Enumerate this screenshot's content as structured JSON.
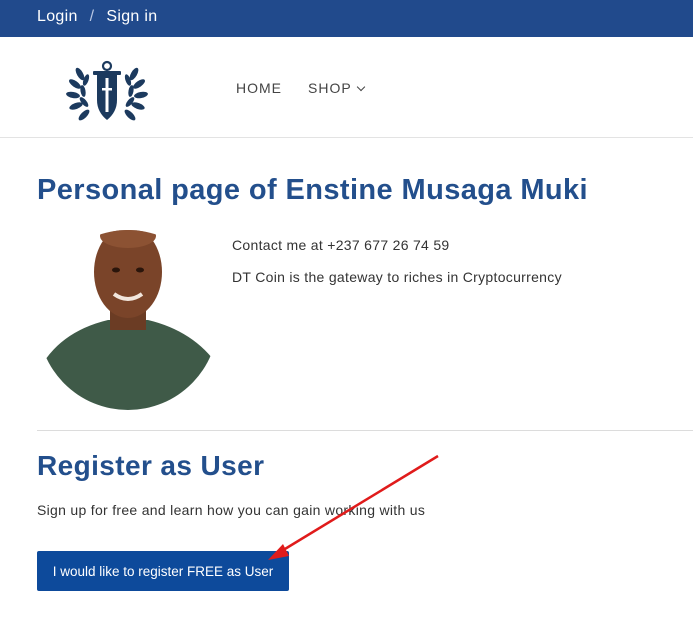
{
  "topbar": {
    "login": "Login",
    "separator": "/",
    "signin": "Sign in",
    "bg": "#214a8c"
  },
  "header": {
    "logo_icon": "anchor-laurel-logo",
    "nav": [
      {
        "label": "HOME"
      },
      {
        "label": "SHOP"
      }
    ]
  },
  "profile": {
    "title": "Personal page of Enstine Musaga Muki",
    "contact": "Contact me at +237 677 26 74 59",
    "tagline": "DT Coin is the gateway to riches in Cryptocurrency"
  },
  "register": {
    "title": "Register as User",
    "text": "Sign up for free and learn how you can gain working with us",
    "button_label": "I would like to register FREE as User",
    "button_color": "#0d4a9b"
  },
  "annotation": {
    "type": "red-arrow",
    "color": "#e01b1b"
  },
  "colors": {
    "heading": "#234f8c"
  }
}
